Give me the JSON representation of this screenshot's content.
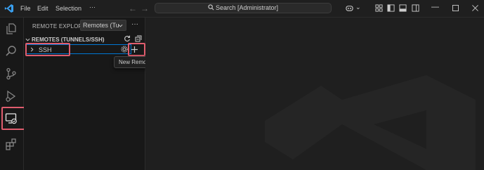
{
  "titlebar": {
    "menus": [
      "File",
      "Edit",
      "Selection"
    ],
    "more": "···",
    "search_text": "Search [Administrator]",
    "copilot_caret": "⌄"
  },
  "sidebar": {
    "title": "REMOTE EXPLOR...",
    "remotes_select": "Remotes (Tu",
    "more": "···",
    "section_header": "REMOTES (TUNNELS/SSH)",
    "items": [
      {
        "label": "SSH"
      }
    ]
  },
  "tooltip": {
    "text": "New Remote"
  },
  "colors": {
    "accent": "#0078d4",
    "highlight": "#e05d6e",
    "logo": "#3aa0f0"
  }
}
